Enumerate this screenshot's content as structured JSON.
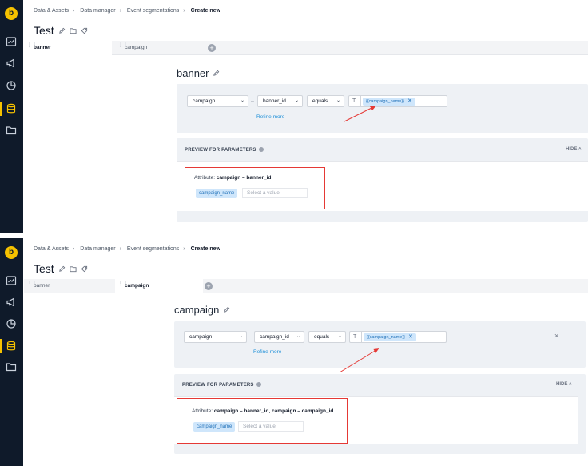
{
  "colors": {
    "rail": "#0f1a2a",
    "accent_yellow": "#f6c200",
    "chip_bg": "#cfe6fb",
    "chip_text": "#1d6fb8",
    "annotation_red": "#e53935",
    "link_blue": "#1d8fd8"
  },
  "sidebar": {
    "logo": "b",
    "icons": [
      "dashboard-icon",
      "megaphone-icon",
      "pie-chart-icon",
      "database-icon",
      "folder-icon"
    ]
  },
  "top": {
    "breadcrumb": [
      "Data & Assets",
      "Data manager",
      "Event segmentations",
      "Create new"
    ],
    "page_title": "Test",
    "tabs": [
      "banner",
      "campaign"
    ],
    "segment_title": "banner",
    "filter": {
      "attribute": "campaign",
      "dash": "–",
      "property": "banner_id",
      "operator": "equals",
      "type_icon": "T",
      "parameter_chip": "{{campaign_name}}",
      "refine": "Refine more"
    },
    "preview": {
      "header": "PREVIEW FOR PARAMETERS",
      "hide": "HIDE",
      "attribute_label": "Attribute:",
      "attribute_value": "campaign – banner_id",
      "param_name": "campaign_name",
      "placeholder": "Select a value"
    }
  },
  "bottom": {
    "breadcrumb": [
      "Data & Assets",
      "Data manager",
      "Event segmentations",
      "Create new"
    ],
    "page_title": "Test",
    "tabs": [
      "banner",
      "campaign"
    ],
    "segment_title": "campaign",
    "filter": {
      "attribute": "campaign",
      "dash": "–",
      "property": "campaign_id",
      "operator": "equals",
      "type_icon": "T",
      "parameter_chip": "{{campaign_name}}",
      "refine": "Refine more",
      "close": "×"
    },
    "preview": {
      "header": "PREVIEW FOR PARAMETERS",
      "hide": "HIDE",
      "attribute_label": "Attribute:",
      "attribute_value": "campaign – banner_id, campaign – campaign_id",
      "param_name": "campaign_name",
      "placeholder": "Select a value"
    }
  }
}
